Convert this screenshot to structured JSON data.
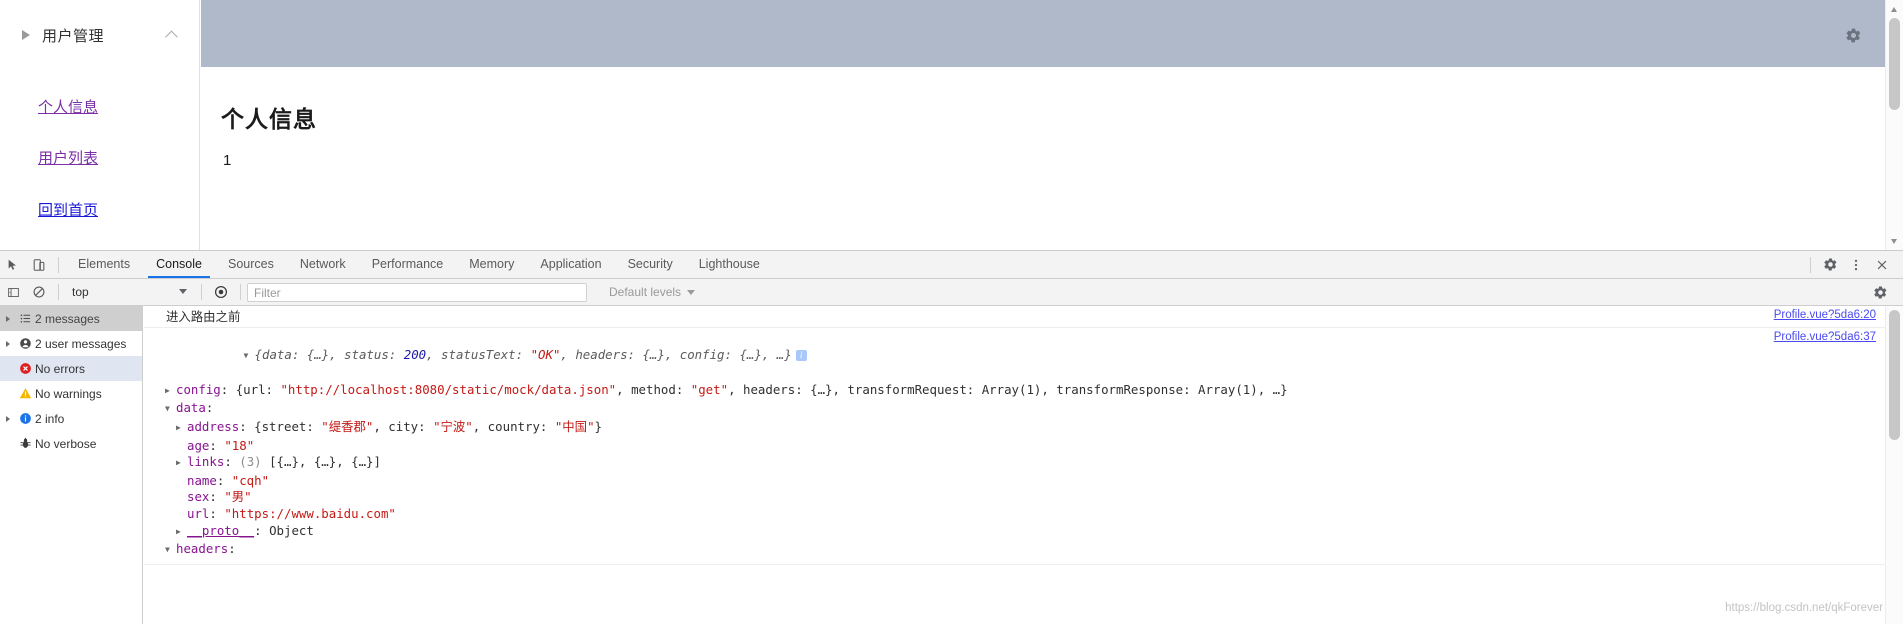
{
  "page": {
    "sidebar": {
      "menu_group_label": "用户管理",
      "expand_arrow_icon": "triangle-right-icon",
      "collapse_chevron_icon": "chevron-up-icon",
      "links": [
        {
          "label": "个人信息",
          "state": "visited"
        },
        {
          "label": "用户列表",
          "state": "visited"
        },
        {
          "label": "回到首页",
          "state": "unvisited"
        }
      ]
    },
    "content": {
      "topbar_color": "#b0b9c9",
      "gear_icon": "gear-icon",
      "title": "个人信息",
      "counter": "1"
    }
  },
  "devtools": {
    "toolbar": {
      "inspect_icon": "inspect-cursor-icon",
      "device_toggle_icon": "device-toolbar-icon",
      "tabs": [
        {
          "label": "Elements",
          "active": false
        },
        {
          "label": "Console",
          "active": true
        },
        {
          "label": "Sources",
          "active": false
        },
        {
          "label": "Network",
          "active": false
        },
        {
          "label": "Performance",
          "active": false
        },
        {
          "label": "Memory",
          "active": false
        },
        {
          "label": "Application",
          "active": false
        },
        {
          "label": "Security",
          "active": false
        },
        {
          "label": "Lighthouse",
          "active": false
        }
      ],
      "settings_icon": "gear-icon",
      "more_icon": "kebab-menu-icon",
      "close_icon": "close-icon"
    },
    "filterbar": {
      "sidebar_toggle_icon": "console-sidebar-icon",
      "clear_icon": "clear-console-icon",
      "context": "top",
      "eye_icon": "live-expression-icon",
      "filter_placeholder": "Filter",
      "filter_value": "",
      "levels_label": "Default levels",
      "settings_icon": "gear-icon"
    },
    "sidebar": [
      {
        "label": "2 messages",
        "icon": "list-icon",
        "arrow": true,
        "state": "header"
      },
      {
        "label": "2 user messages",
        "icon": "user-icon",
        "arrow": true,
        "state": "normal"
      },
      {
        "label": "No errors",
        "icon": "error-icon",
        "arrow": false,
        "state": "selected"
      },
      {
        "label": "No warnings",
        "icon": "warning-icon",
        "arrow": false,
        "state": "normal"
      },
      {
        "label": "2 info",
        "icon": "info-icon",
        "arrow": true,
        "state": "normal"
      },
      {
        "label": "No verbose",
        "icon": "bug-icon",
        "arrow": false,
        "state": "normal"
      }
    ],
    "messages": [
      {
        "text": "进入路由之前",
        "source": "Profile.vue?5da6:20"
      },
      {
        "source": "Profile.vue?5da6:37",
        "preview": {
          "open_toggle": "triangle-down-icon",
          "head": "{data: {…}, status: ",
          "status_value": "200",
          "mid": ", statusText: ",
          "status_text": "\"OK\"",
          "tail": ", headers: {…}, config: {…}, …}",
          "info_badge": "i"
        },
        "rows": [
          {
            "indent": 1,
            "toggle": "closed",
            "key": "config",
            "value_parts": [
              {
                "t": "{url: ",
                "c": "kv"
              },
              {
                "t": "\"http://localhost:8080/static/mock/data.json\"",
                "c": "str"
              },
              {
                "t": ", method: ",
                "c": "kv"
              },
              {
                "t": "\"get\"",
                "c": "str"
              },
              {
                "t": ", headers: {…}, transformRequest: Array(1), transformResponse: Array(1), …}",
                "c": "kv"
              }
            ]
          },
          {
            "indent": 1,
            "toggle": "open",
            "key": "data",
            "value_parts": []
          },
          {
            "indent": 2,
            "toggle": "closed",
            "key": "address",
            "value_parts": [
              {
                "t": "{street: ",
                "c": "kv"
              },
              {
                "t": "\"缇香郡\"",
                "c": "str"
              },
              {
                "t": ", city: ",
                "c": "kv"
              },
              {
                "t": "\"宁波\"",
                "c": "str"
              },
              {
                "t": ", country: ",
                "c": "kv"
              },
              {
                "t": "\"中国\"",
                "c": "str"
              },
              {
                "t": "}",
                "c": "kv"
              }
            ]
          },
          {
            "indent": 2,
            "toggle": "none",
            "key": "age",
            "value_parts": [
              {
                "t": "\"18\"",
                "c": "str"
              }
            ]
          },
          {
            "indent": 2,
            "toggle": "closed",
            "key": "links",
            "value_parts": [
              {
                "t": "(3) ",
                "c": "gr"
              },
              {
                "t": "[{…}, {…}, {…}]",
                "c": "kv"
              }
            ]
          },
          {
            "indent": 2,
            "toggle": "none",
            "key": "name",
            "value_parts": [
              {
                "t": "\"cqh\"",
                "c": "str"
              }
            ]
          },
          {
            "indent": 2,
            "toggle": "none",
            "key": "sex",
            "value_parts": [
              {
                "t": "\"男\"",
                "c": "str"
              }
            ]
          },
          {
            "indent": 2,
            "toggle": "none",
            "key": "url",
            "value_parts": [
              {
                "t": "\"https://www.baidu.com\"",
                "c": "str"
              }
            ]
          },
          {
            "indent": 2,
            "toggle": "closed",
            "key": "__proto__",
            "underline_key": true,
            "value_parts": [
              {
                "t": "Object",
                "c": "kv"
              }
            ]
          },
          {
            "indent": 1,
            "toggle": "open",
            "key": "headers",
            "value_parts": []
          }
        ]
      }
    ],
    "watermark": "https://blog.csdn.net/qkForever"
  }
}
